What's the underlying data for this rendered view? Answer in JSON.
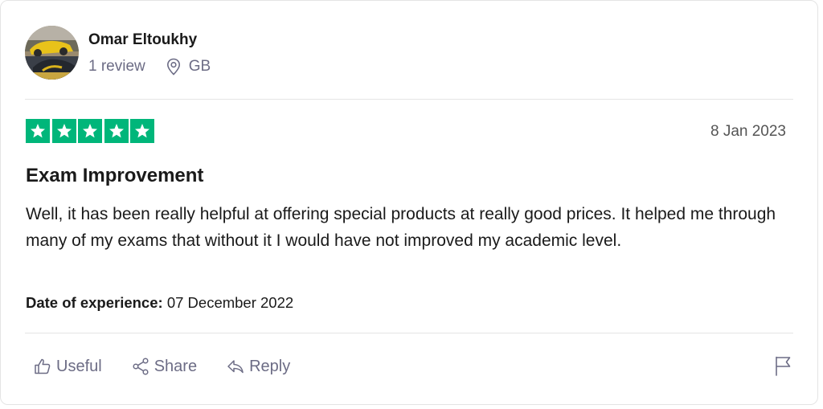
{
  "reviewer": {
    "name": "Omar Eltoukhy",
    "review_count": "1 review",
    "country": "GB"
  },
  "review": {
    "rating": 5,
    "rating_max": 5,
    "star_color": "#00b67a",
    "date": "8 Jan 2023",
    "title": "Exam Improvement",
    "body": "Well, it has been really helpful at offering special products at really good prices. It helped me through many of my exams that without it I would have not improved my academic level.",
    "experience_label": "Date of experience:",
    "experience_date": "07 December 2022"
  },
  "actions": {
    "useful_label": "Useful",
    "share_label": "Share",
    "reply_label": "Reply"
  },
  "icons": {
    "avatar": "avatar-photo",
    "location": "location-pin-icon",
    "star": "star-icon",
    "useful": "thumbs-up-icon",
    "share": "share-icon",
    "reply": "reply-icon",
    "report": "flag-icon"
  }
}
